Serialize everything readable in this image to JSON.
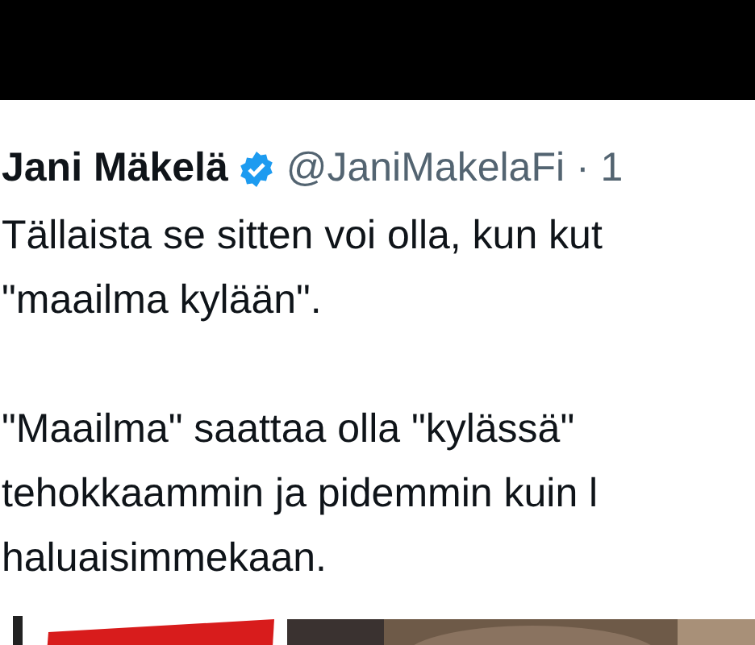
{
  "tweet": {
    "author": {
      "name": "Jani Mäkelä",
      "verified": true,
      "handle": "@JaniMakelaFi · 1"
    },
    "paragraphs": [
      {
        "lines": [
          "Tällaista se sitten voi olla, kun kut",
          "\"maailma kylään\"."
        ]
      },
      {
        "lines": [
          "\"Maailma\" saattaa olla \"kylässä\"",
          "tehokkaammin ja pidemmin kuin l",
          "haluaisimmekaan."
        ]
      }
    ]
  }
}
